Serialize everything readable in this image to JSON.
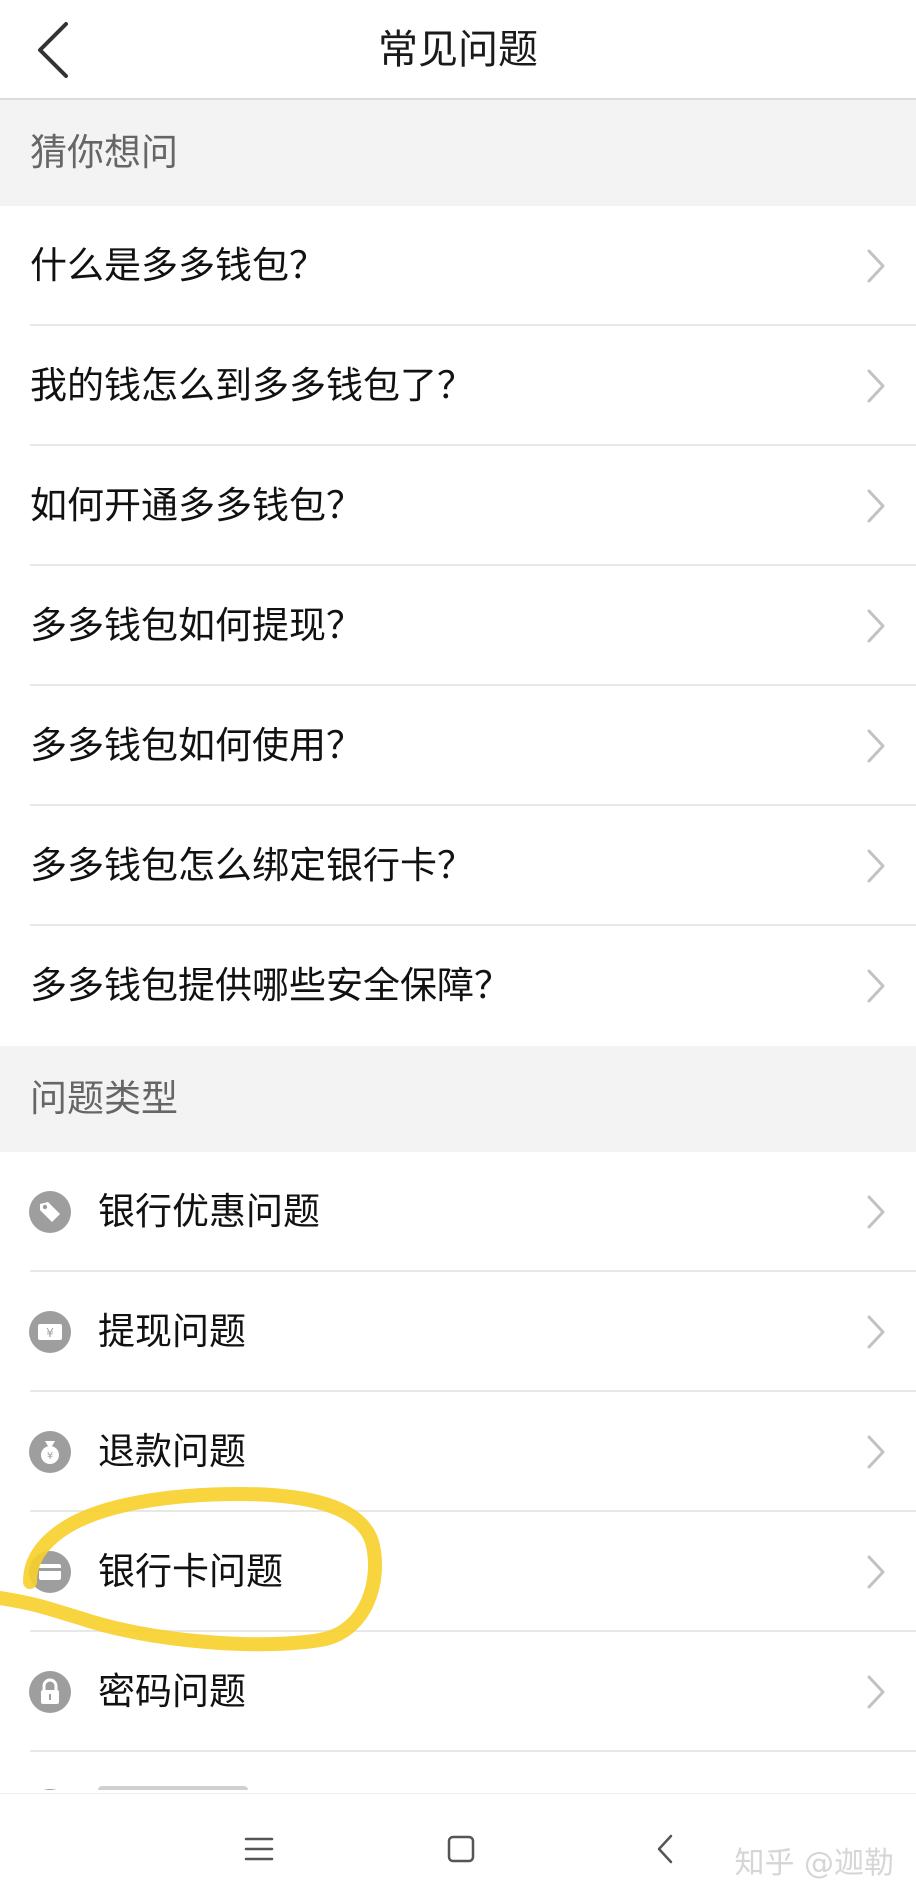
{
  "header": {
    "title": "常见问题",
    "back_icon": "chevron-left-icon"
  },
  "guess_section": {
    "title": "猜你想问",
    "items": [
      {
        "label": "什么是多多钱包？"
      },
      {
        "label": "我的钱怎么到多多钱包了？"
      },
      {
        "label": "如何开通多多钱包？"
      },
      {
        "label": "多多钱包如何提现？"
      },
      {
        "label": "多多钱包如何使用？"
      },
      {
        "label": "多多钱包怎么绑定银行卡？"
      },
      {
        "label": "多多钱包提供哪些安全保障？"
      }
    ]
  },
  "type_section": {
    "title": "问题类型",
    "items": [
      {
        "label": "银行优惠问题",
        "icon": "price-tag-icon"
      },
      {
        "label": "提现问题",
        "icon": "yuan-ticket-icon"
      },
      {
        "label": "退款问题",
        "icon": "money-bag-icon"
      },
      {
        "label": "银行卡问题",
        "icon": "bank-card-icon"
      },
      {
        "label": "密码问题",
        "icon": "lock-icon"
      }
    ]
  },
  "colors": {
    "icon_gray": "#9e9e9e",
    "chevron": "#c2c2c2",
    "section_bg": "#f3f3f3",
    "highlight": "#f7cf2a"
  },
  "navbar": {
    "icons": [
      "menu-icon",
      "home-square-icon",
      "back-triangle-icon"
    ]
  },
  "watermark": "知乎 @迦勒"
}
